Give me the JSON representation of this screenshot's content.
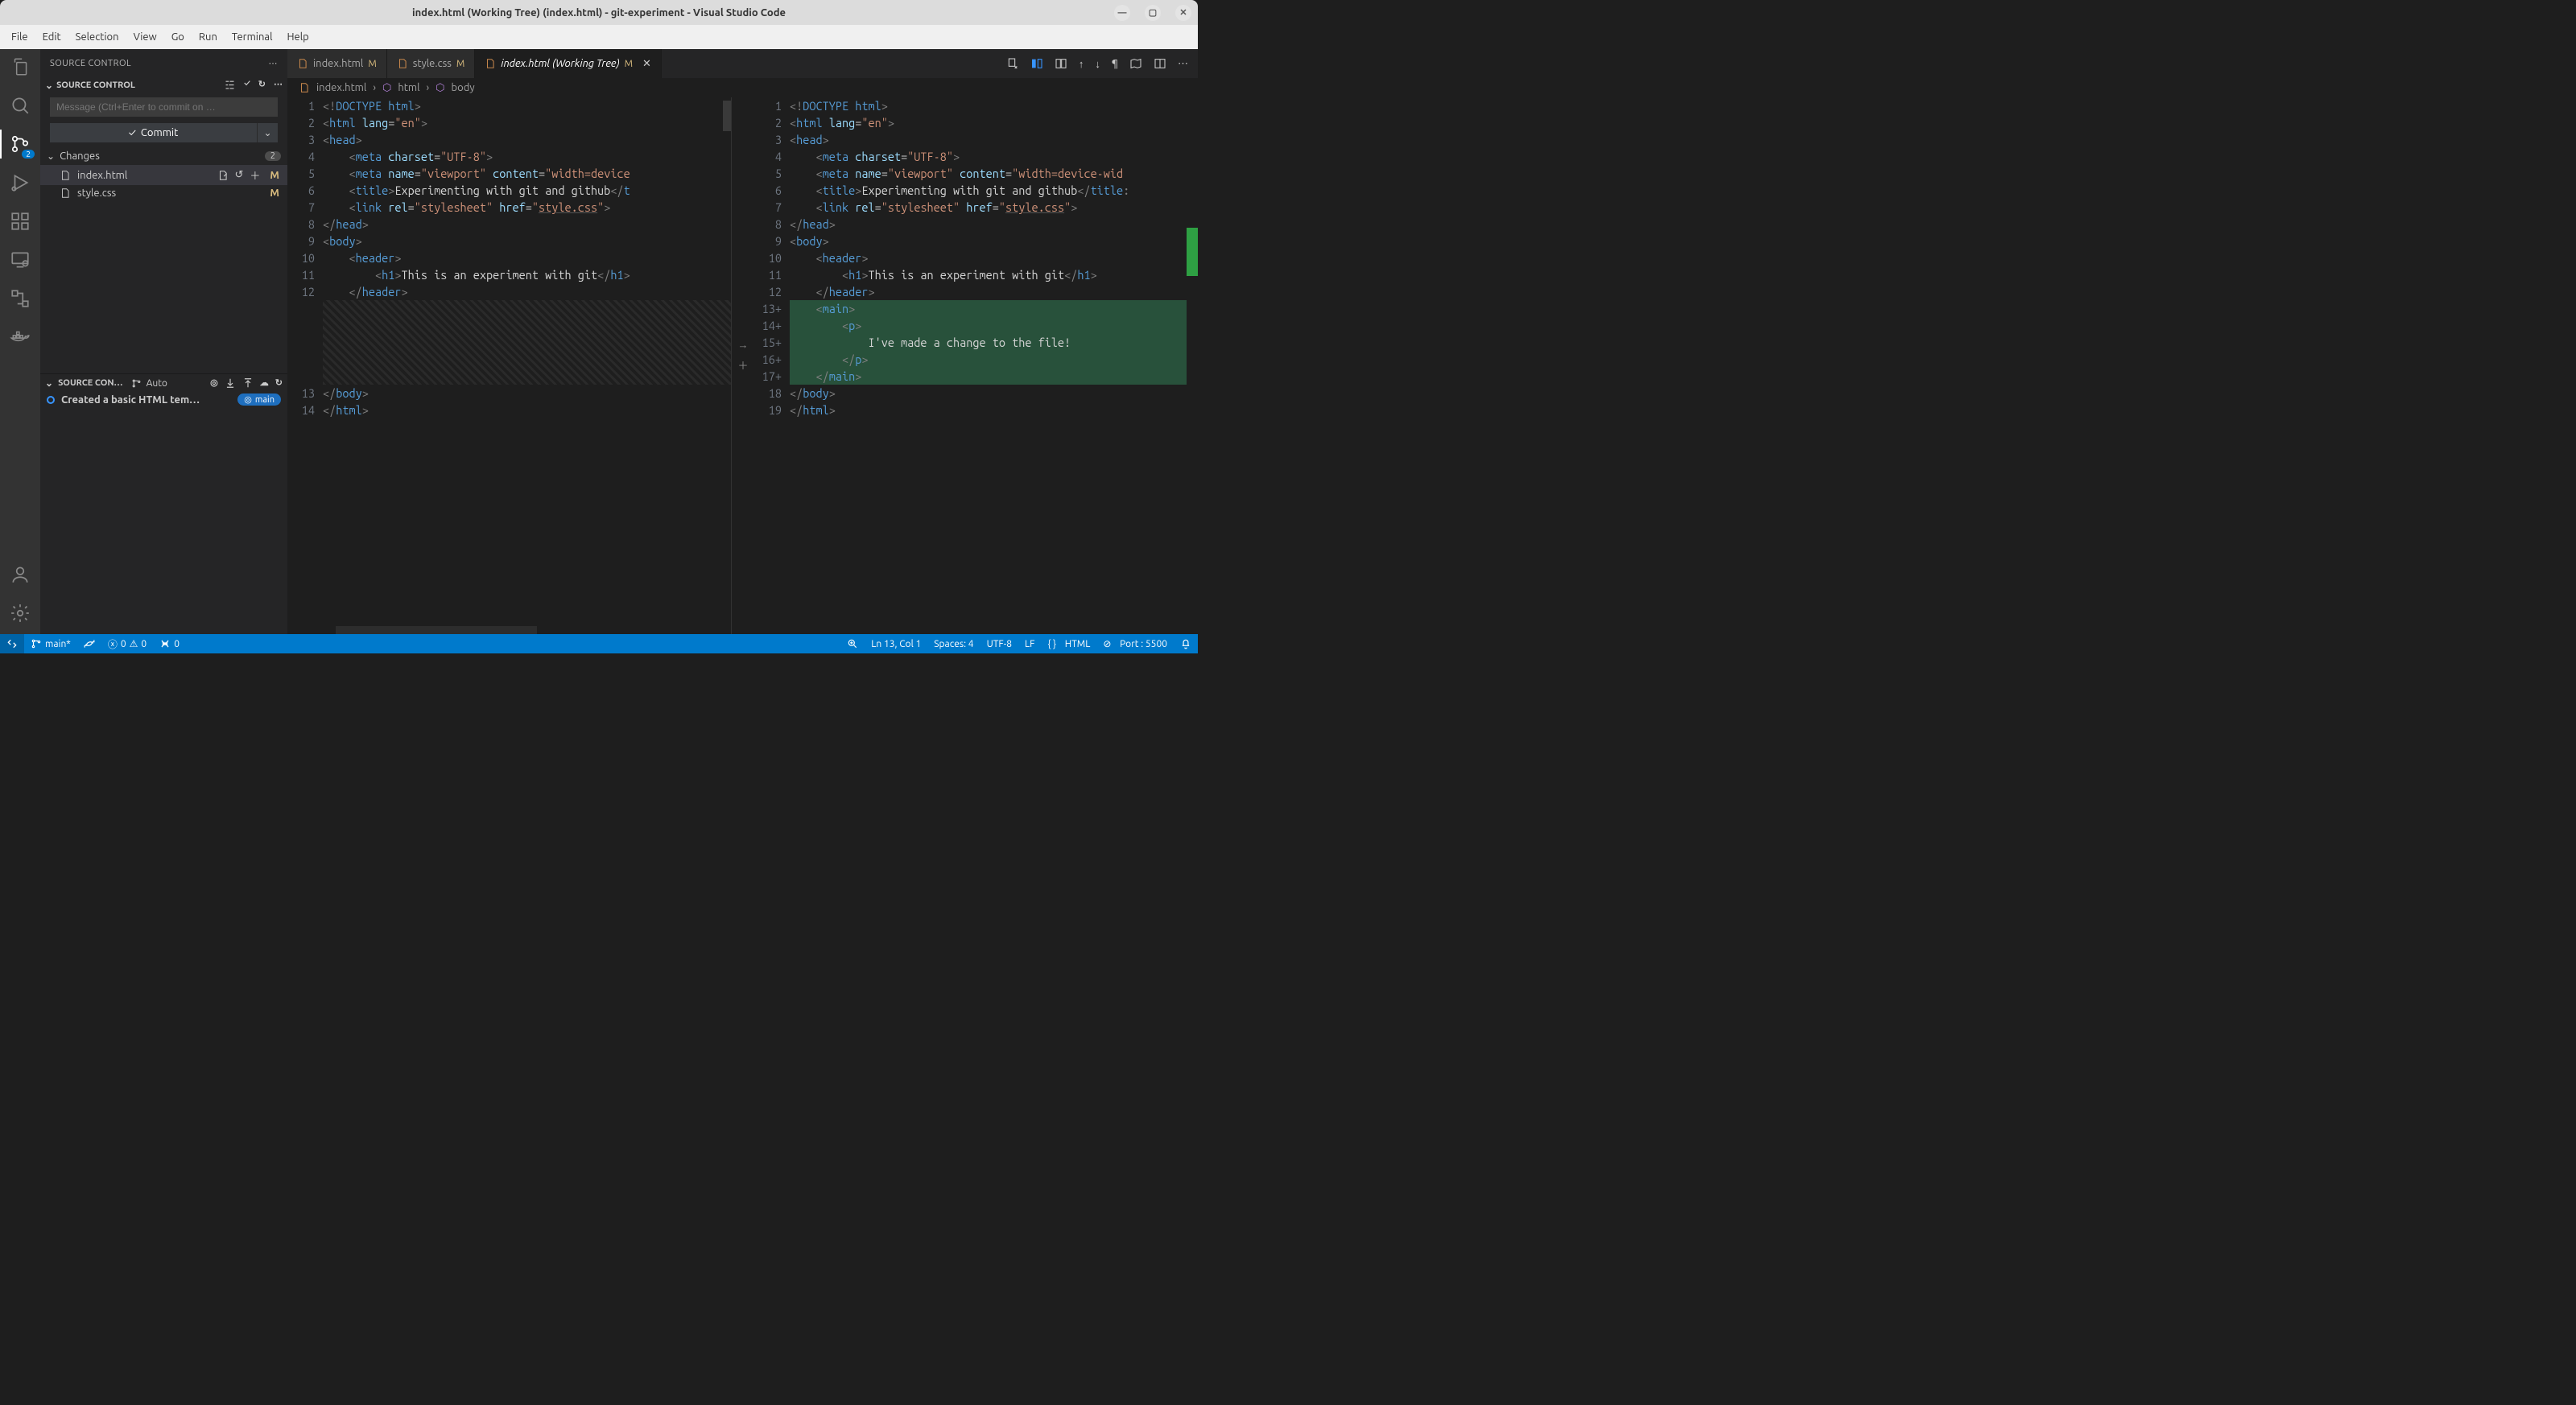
{
  "titlebar": {
    "title": "index.html (Working Tree) (index.html) - git-experiment - Visual Studio Code"
  },
  "menu": [
    "File",
    "Edit",
    "Selection",
    "View",
    "Go",
    "Run",
    "Terminal",
    "Help"
  ],
  "activity": {
    "scm_badge": "2"
  },
  "sidebar": {
    "title": "SOURCE CONTROL",
    "sectionTitle": "SOURCE CONTROL",
    "commitPlaceholder": "Message (Ctrl+Enter to commit on …",
    "commitBtn": "Commit",
    "changesLabel": "Changes",
    "changesCount": "2",
    "files": [
      {
        "name": "index.html",
        "status": "M",
        "selected": true,
        "hasActions": true
      },
      {
        "name": "style.css",
        "status": "M",
        "selected": false,
        "hasActions": false
      }
    ],
    "graphTitle": "SOURCE CON…",
    "auto": "Auto",
    "commitMsg": "Created a basic HTML tem…",
    "branch": "main"
  },
  "tabs": [
    {
      "name": "index.html",
      "status": "M",
      "active": false,
      "italic": false
    },
    {
      "name": "style.css",
      "status": "M",
      "active": false,
      "italic": false
    },
    {
      "name": "index.html (Working Tree)",
      "status": "M",
      "active": true,
      "italic": true,
      "close": true
    }
  ],
  "breadcrumb": [
    "index.html",
    "html",
    "body"
  ],
  "diff": {
    "left": {
      "lines": [
        {
          "n": "1",
          "html": "<span class='t-brkt'>&lt;!</span><span class='t-doctype'>DOCTYPE</span> <span class='t-doctype'>html</span><span class='t-brkt'>&gt;</span>"
        },
        {
          "n": "2",
          "html": "<span class='t-brkt'>&lt;</span><span class='t-tag'>html</span> <span class='t-attr'>lang</span>=<span class='t-str'>\"en\"</span><span class='t-brkt'>&gt;</span>"
        },
        {
          "n": "3",
          "html": "<span class='t-brkt'>&lt;</span><span class='t-tag'>head</span><span class='t-brkt'>&gt;</span>"
        },
        {
          "n": "4",
          "html": "    <span class='t-brkt'>&lt;</span><span class='t-tag'>meta</span> <span class='t-attr'>charset</span>=<span class='t-str'>\"UTF-8\"</span><span class='t-brkt'>&gt;</span>"
        },
        {
          "n": "5",
          "html": "    <span class='t-brkt'>&lt;</span><span class='t-tag'>meta</span> <span class='t-attr'>name</span>=<span class='t-str'>\"viewport\"</span> <span class='t-attr'>content</span>=<span class='t-str'>\"width=device</span>"
        },
        {
          "n": "6",
          "html": "    <span class='t-brkt'>&lt;</span><span class='t-tag'>title</span><span class='t-brkt'>&gt;</span><span class='t-text'>Experimenting with git and github</span><span class='t-brkt'>&lt;/</span><span class='t-tag'>t</span>"
        },
        {
          "n": "7",
          "html": "    <span class='t-brkt'>&lt;</span><span class='t-tag'>link</span> <span class='t-attr'>rel</span>=<span class='t-str'>\"stylesheet\"</span> <span class='t-attr'>href</span>=<span class='t-str'>\"</span><span class='t-link'>style.css</span><span class='t-str'>\"</span><span class='t-brkt'>&gt;</span>"
        },
        {
          "n": "8",
          "html": "<span class='t-brkt'>&lt;/</span><span class='t-tag'>head</span><span class='t-brkt'>&gt;</span>"
        },
        {
          "n": "9",
          "html": "<span class='t-brkt'>&lt;</span><span class='t-tag'>body</span><span class='t-brkt'>&gt;</span>"
        },
        {
          "n": "10",
          "html": "    <span class='t-brkt'>&lt;</span><span class='t-tag'>header</span><span class='t-brkt'>&gt;</span>"
        },
        {
          "n": "11",
          "html": "        <span class='t-brkt'>&lt;</span><span class='t-tag'>h1</span><span class='t-brkt'>&gt;</span><span class='t-text'>This is an experiment with git</span><span class='t-brkt'>&lt;/</span><span class='t-tag'>h1</span><span class='t-brkt'>&gt;</span>"
        },
        {
          "n": "12",
          "html": "    <span class='t-brkt'>&lt;/</span><span class='t-tag'>header</span><span class='t-brkt'>&gt;</span>"
        }
      ],
      "hatch": true,
      "tail": [
        {
          "n": "13",
          "html": "<span class='t-brkt'>&lt;/</span><span class='t-tag'>body</span><span class='t-brkt'>&gt;</span>"
        },
        {
          "n": "14",
          "html": "<span class='t-brkt'>&lt;/</span><span class='t-tag'>html</span><span class='t-brkt'>&gt;</span>"
        }
      ]
    },
    "right": {
      "lines": [
        {
          "n": "1",
          "html": "<span class='t-brkt'>&lt;!</span><span class='t-doctype'>DOCTYPE</span> <span class='t-doctype'>html</span><span class='t-brkt'>&gt;</span>"
        },
        {
          "n": "2",
          "html": "<span class='t-brkt'>&lt;</span><span class='t-tag'>html</span> <span class='t-attr'>lang</span>=<span class='t-str'>\"en\"</span><span class='t-brkt'>&gt;</span>"
        },
        {
          "n": "3",
          "html": "<span class='t-brkt'>&lt;</span><span class='t-tag'>head</span><span class='t-brkt'>&gt;</span>"
        },
        {
          "n": "4",
          "html": "    <span class='t-brkt'>&lt;</span><span class='t-tag'>meta</span> <span class='t-attr'>charset</span>=<span class='t-str'>\"UTF-8\"</span><span class='t-brkt'>&gt;</span>"
        },
        {
          "n": "5",
          "html": "    <span class='t-brkt'>&lt;</span><span class='t-tag'>meta</span> <span class='t-attr'>name</span>=<span class='t-str'>\"viewport\"</span> <span class='t-attr'>content</span>=<span class='t-str'>\"width=device-wid</span>"
        },
        {
          "n": "6",
          "html": "    <span class='t-brkt'>&lt;</span><span class='t-tag'>title</span><span class='t-brkt'>&gt;</span><span class='t-text'>Experimenting with git and github</span><span class='t-brkt'>&lt;/</span><span class='t-tag'>title</span><span class='t-brkt'>:</span>"
        },
        {
          "n": "7",
          "html": "    <span class='t-brkt'>&lt;</span><span class='t-tag'>link</span> <span class='t-attr'>rel</span>=<span class='t-str'>\"stylesheet\"</span> <span class='t-attr'>href</span>=<span class='t-str'>\"</span><span class='t-link'>style.css</span><span class='t-str'>\"</span><span class='t-brkt'>&gt;</span>"
        },
        {
          "n": "8",
          "html": "<span class='t-brkt'>&lt;/</span><span class='t-tag'>head</span><span class='t-brkt'>&gt;</span>"
        },
        {
          "n": "9",
          "html": "<span class='t-brkt'>&lt;</span><span class='t-tag'>body</span><span class='t-brkt'>&gt;</span>"
        },
        {
          "n": "10",
          "html": "    <span class='t-brkt'>&lt;</span><span class='t-tag'>header</span><span class='t-brkt'>&gt;</span>"
        },
        {
          "n": "11",
          "html": "        <span class='t-brkt'>&lt;</span><span class='t-tag'>h1</span><span class='t-brkt'>&gt;</span><span class='t-text'>This is an experiment with git</span><span class='t-brkt'>&lt;/</span><span class='t-tag'>h1</span><span class='t-brkt'>&gt;</span>"
        },
        {
          "n": "12",
          "html": "    <span class='t-brkt'>&lt;/</span><span class='t-tag'>header</span><span class='t-brkt'>&gt;</span>"
        },
        {
          "n": "13+",
          "added": true,
          "html": "    <span class='t-brkt'>&lt;</span><span class='t-tag'>main</span><span class='t-brkt'>&gt;</span>"
        },
        {
          "n": "14+",
          "added": true,
          "html": "        <span class='t-brkt'>&lt;</span><span class='t-tag'>p</span><span class='t-brkt'>&gt;</span>"
        },
        {
          "n": "15+",
          "added": true,
          "html": "            <span class='t-text'>I've made a change to the file!</span>"
        },
        {
          "n": "16+",
          "added": true,
          "html": "        <span class='t-brkt'>&lt;/</span><span class='t-tag'>p</span><span class='t-brkt'>&gt;</span>"
        },
        {
          "n": "17+",
          "added": true,
          "html": "    <span class='t-brkt'>&lt;/</span><span class='t-tag'>main</span><span class='t-brkt'>&gt;</span>"
        },
        {
          "n": "18",
          "html": "<span class='t-brkt'>&lt;/</span><span class='t-tag'>body</span><span class='t-brkt'>&gt;</span>"
        },
        {
          "n": "19",
          "html": "<span class='t-brkt'>&lt;/</span><span class='t-tag'>html</span><span class='t-brkt'>&gt;</span>"
        }
      ]
    }
  },
  "statusbar": {
    "branch": "main*",
    "errors": "0",
    "warnings": "0",
    "port0": "0",
    "lncol": "Ln 13, Col 1",
    "spaces": "Spaces: 4",
    "encoding": "UTF-8",
    "eol": "LF",
    "lang": "HTML",
    "port": "Port : 5500"
  }
}
